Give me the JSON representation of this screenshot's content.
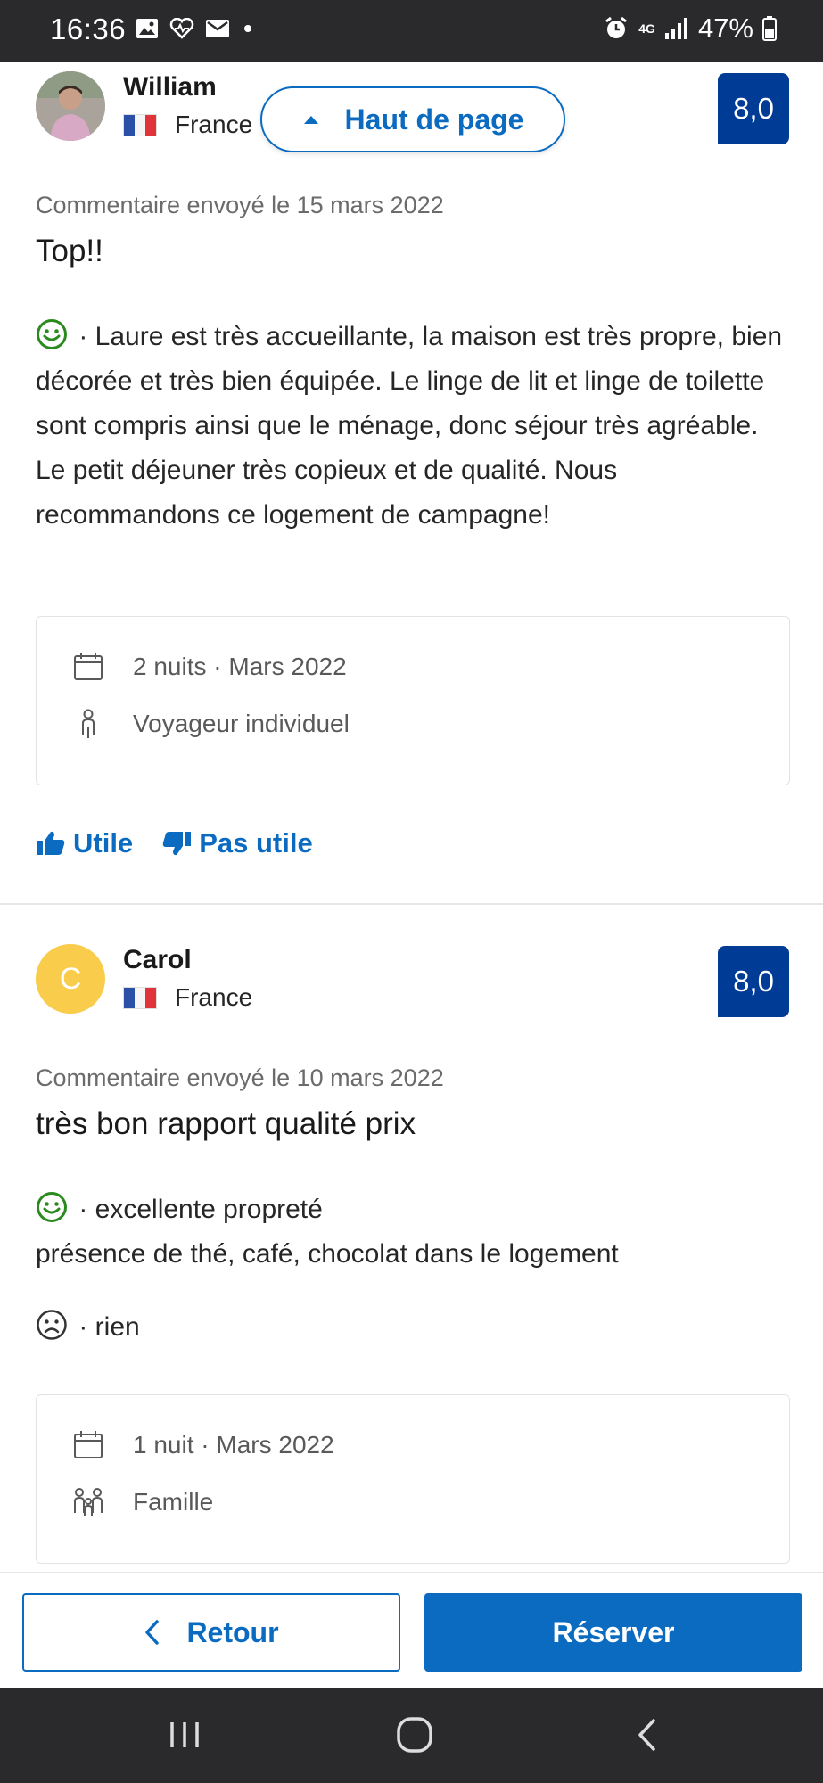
{
  "status_bar": {
    "time": "16:36",
    "network": "4G",
    "battery": "47%"
  },
  "back_to_top": {
    "label": "Haut de page"
  },
  "reviews": [
    {
      "name": "William",
      "country": "France",
      "score": "8,0",
      "date": "Commentaire envoyé le 15 mars 2022",
      "title": "Top!!",
      "positive": " · Laure est très accueillante, la maison est très propre, bien décorée et très bien équipée. Le linge de lit et linge de toilette sont compris ainsi que le ménage, donc séjour très agréable. Le petit déjeuner très copieux et de qualité. Nous recommandons ce logement de campagne!",
      "stay": "2 nuits · Mars 2022",
      "traveler": "Voyageur individuel",
      "helpful_label": "Utile",
      "not_helpful_label": "Pas utile"
    },
    {
      "name": "Carol",
      "avatar_letter": "C",
      "country": "France",
      "score": "8,0",
      "date": "Commentaire envoyé le 10 mars 2022",
      "title": "très bon rapport qualité prix",
      "positive_line1": " · excellente propreté",
      "positive_line2": "présence de thé, café, chocolat dans le logement",
      "negative": " · rien",
      "stay": "1 nuit · Mars 2022",
      "traveler": "Famille"
    }
  ],
  "actions": {
    "back_label": "Retour",
    "book_label": "Réserver"
  },
  "colors": {
    "accent": "#0a6bc1",
    "score_bg": "#003b95",
    "positive": "#2b8a1e"
  }
}
